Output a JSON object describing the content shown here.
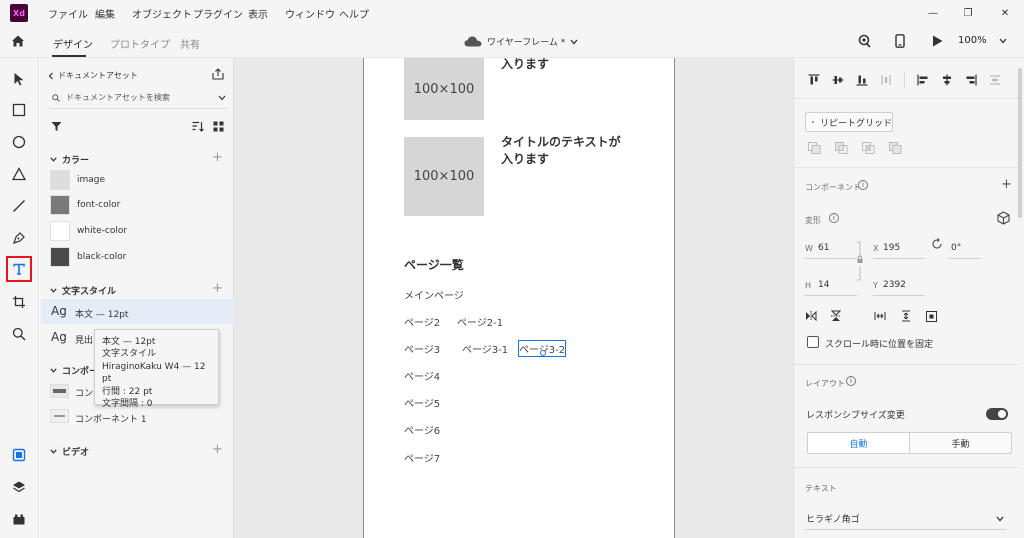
{
  "app": {
    "logo": "Xd"
  },
  "menu": [
    "ファイル",
    "編集",
    "オブジェクト",
    "プラグイン",
    "表示",
    "ウィンドウ",
    "ヘルプ"
  ],
  "window_controls": {
    "minimize": "—",
    "restore": "❐",
    "close": "✕"
  },
  "toolbar": {
    "tabs": [
      "デザイン",
      "プロトタイプ",
      "共有"
    ],
    "doc_title": "ワイヤーフレーム *",
    "zoom": "100%"
  },
  "assets": {
    "back_label": "ドキュメントアセット",
    "search_placeholder": "ドキュメントアセットを検索",
    "colors_header": "カラー",
    "colors": [
      {
        "name": "image",
        "hex": "#dcdcdc"
      },
      {
        "name": "font-color",
        "hex": "#7a7a7a"
      },
      {
        "name": "white-color",
        "hex": "#ffffff"
      },
      {
        "name": "black-color",
        "hex": "#4a4a4a"
      }
    ],
    "text_styles_header": "文字スタイル",
    "text_styles": [
      {
        "glyph": "Ag",
        "label": "本文 — 12pt"
      },
      {
        "glyph": "Ag",
        "label": "見出"
      }
    ],
    "components_header": "コンポーネ",
    "components": [
      "コンポ",
      "コンポーネント 1"
    ],
    "video_header": "ビデオ"
  },
  "tooltip": {
    "lines": [
      "本文 — 12pt",
      "文字スタイル",
      "HiraginoKaku W4 — 12 pt",
      "行間 : 22 pt",
      "文字間隔 : 0"
    ]
  },
  "artboard": {
    "card_top_title": "入ります",
    "placeholder_label": "100×100",
    "card_title_line1": "タイトルのテキストが",
    "card_title_line2": "入ります",
    "pages_heading": "ページ一覧",
    "pages": {
      "main": "メインページ",
      "p2": "ページ2",
      "p2_1": "ページ2-1",
      "p3": "ページ3",
      "p3_1": "ページ3-1",
      "p3_2": "ページ3-2",
      "p4": "ページ4",
      "p5": "ページ5",
      "p6": "ページ6",
      "p7": "ページ7"
    }
  },
  "props": {
    "repeat_grid": "リピートグリッド",
    "component_label": "コンポーネント",
    "transform_label": "変形",
    "w_label": "W",
    "w_value": "61",
    "h_label": "H",
    "h_value": "14",
    "x_label": "X",
    "x_value": "195",
    "y_label": "Y",
    "y_value": "2392",
    "rotation": "0°",
    "fix_scroll": "スクロール時に位置を固定",
    "layout_label": "レイアウト",
    "responsive": "レスポンシブサイズ変更",
    "auto": "自動",
    "manual": "手動",
    "text_label": "テキスト",
    "font": "ヒラギノ角ゴ"
  }
}
